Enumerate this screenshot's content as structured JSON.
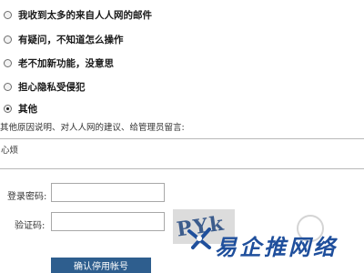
{
  "options": [
    {
      "label": "我收到太多的来自人人网的邮件",
      "checked": false
    },
    {
      "label": "有疑问，不知道怎么操作",
      "checked": false
    },
    {
      "label": "老不加新功能，没意思",
      "checked": false
    },
    {
      "label": "担心隐私受侵犯",
      "checked": false
    },
    {
      "label": "其他",
      "checked": true
    }
  ],
  "reason": {
    "label": "其他原因说明、对人人网的建议、给管理员留言:",
    "value": "心烦"
  },
  "password": {
    "label": "登录密码:",
    "value": ""
  },
  "captcha": {
    "label": "验证码:",
    "value": "",
    "image_text": "PYk"
  },
  "confirm_button": {
    "label": "确认停用帐号"
  },
  "watermark": {
    "text": "易企推网络"
  },
  "colors": {
    "button": "#2e5e8e",
    "watermark": "#1f4f9c"
  }
}
